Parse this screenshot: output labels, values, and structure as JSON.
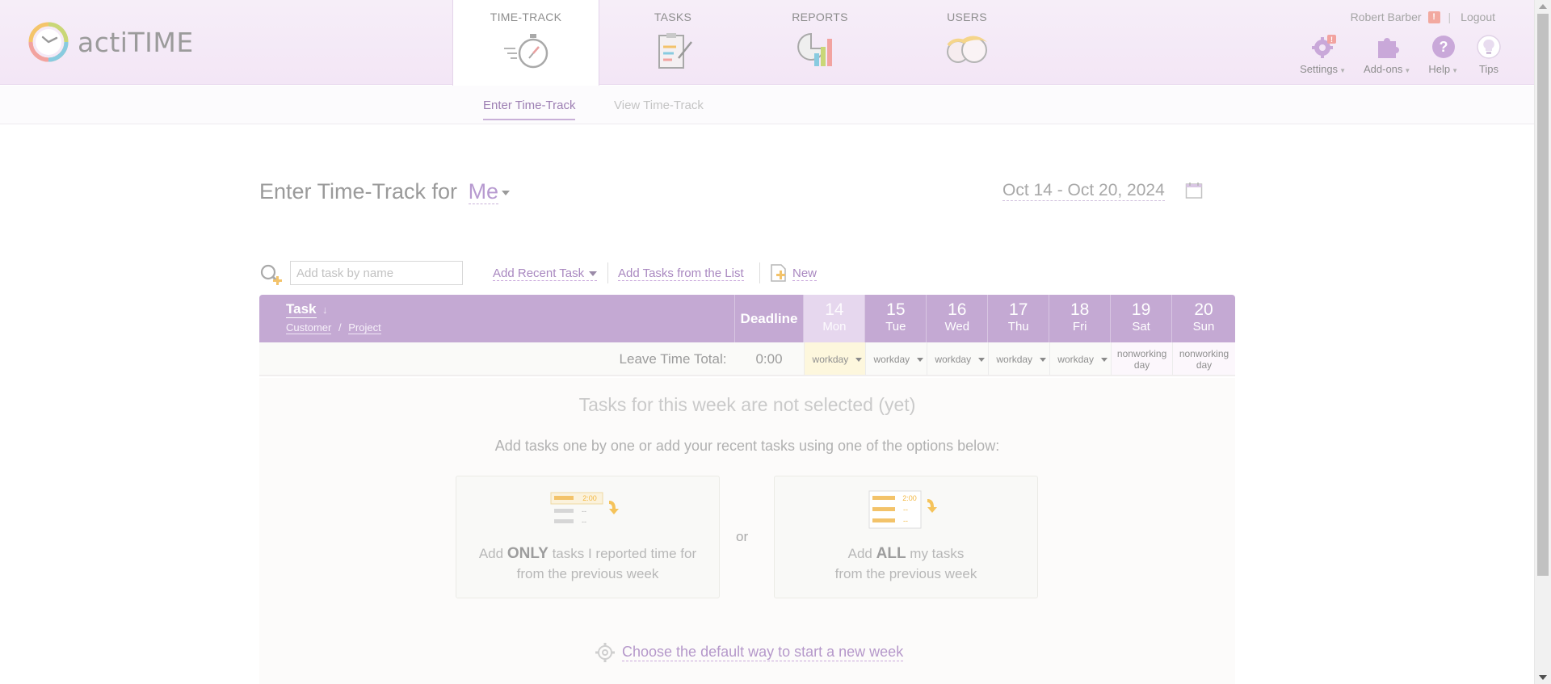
{
  "app": {
    "logo_text": "actiTIME"
  },
  "nav": {
    "tabs": [
      {
        "label": "TIME-TRACK",
        "icon": "stopwatch-icon",
        "active": true
      },
      {
        "label": "TASKS",
        "icon": "clipboard-icon",
        "active": false
      },
      {
        "label": "REPORTS",
        "icon": "chart-icon",
        "active": false
      },
      {
        "label": "USERS",
        "icon": "users-icon",
        "active": false
      }
    ]
  },
  "user": {
    "name": "Robert Barber",
    "warning": "!",
    "separator": "|",
    "logout": "Logout"
  },
  "tools": [
    {
      "label": "Settings",
      "icon": "gear-icon",
      "badge": "!"
    },
    {
      "label": "Add-ons",
      "icon": "puzzle-icon"
    },
    {
      "label": "Help",
      "icon": "help-icon"
    },
    {
      "label": "Tips",
      "icon": "lightbulb-icon"
    }
  ],
  "subnav": {
    "enter": "Enter Time-Track",
    "view": "View Time-Track"
  },
  "page": {
    "title": "Enter Time-Track for",
    "who": "Me",
    "date_range": "Oct 14 - Oct 20, 2024"
  },
  "toolbar": {
    "search_placeholder": "Add task by name",
    "add_recent": "Add Recent Task",
    "add_from_list": "Add Tasks from the List",
    "new_label": "New"
  },
  "grid": {
    "task_header": "Task",
    "sort_arrow": "↓",
    "customer": "Customer",
    "slash": "/",
    "project": "Project",
    "deadline": "Deadline",
    "days": [
      {
        "num": "14",
        "name": "Mon",
        "today": true
      },
      {
        "num": "15",
        "name": "Tue",
        "today": false
      },
      {
        "num": "16",
        "name": "Wed",
        "today": false
      },
      {
        "num": "17",
        "name": "Thu",
        "today": false
      },
      {
        "num": "18",
        "name": "Fri",
        "today": false
      },
      {
        "num": "19",
        "name": "Sat",
        "today": false
      },
      {
        "num": "20",
        "name": "Sun",
        "today": false
      }
    ],
    "leave_label": "Leave Time Total:",
    "leave_total": "0:00",
    "day_types": [
      "workday",
      "workday",
      "workday",
      "workday",
      "workday",
      "nonworking day",
      "nonworking day"
    ]
  },
  "empty": {
    "title": "Tasks for this week are not selected (yet)",
    "subtitle": "Add tasks one by one or add your recent tasks using one of the options below:",
    "left_card": {
      "pre": "Add ",
      "bold": "ONLY",
      "post": " tasks I reported time for",
      "line2": "from the previous week",
      "art_value": "2:00",
      "art_dash": "--"
    },
    "or": "or",
    "right_card": {
      "pre": "Add ",
      "bold": "ALL",
      "post": " my tasks",
      "line2": "from the previous week",
      "art_value": "2:00",
      "art_dash": "--"
    },
    "default_way": "Choose the default way to start a new week"
  },
  "colors": {
    "accent": "#c4a9d3",
    "link": "#a988c0",
    "topbar": "#f3e6f6"
  }
}
